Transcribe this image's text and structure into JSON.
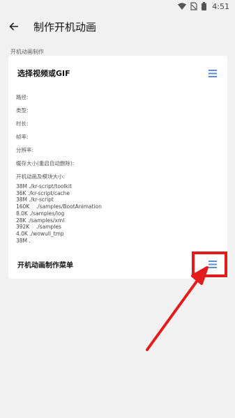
{
  "status": {
    "time": "4:51",
    "icons": [
      "wifi-icon",
      "no-sim-icon",
      "battery-icon"
    ]
  },
  "appbar": {
    "back_icon": "arrow-left-icon",
    "title": "制作开机动画"
  },
  "section_label": "开机动画制作",
  "card": {
    "title": "选择视频或GIF",
    "menu_icon": "menu-lines-icon",
    "info": [
      "路径:",
      "类型:",
      "时长:",
      "帧率:",
      "分辨率:",
      "缓存大小(重启自动删除):",
      "开机动画及模块大小:"
    ],
    "disk_usage": [
      "38M ./kr-script/toolkit",
      "36K ./kr-script/cache",
      "38M ./kr-script",
      "160K    ./samples/BootAnimation",
      "8.0K ./samples/log",
      "28K ./samples/xml",
      "392K    ./samples",
      "4.0K ./wowull_tmp",
      "38M ."
    ],
    "footer_title": "开机动画制作菜单",
    "footer_icon": "menu-lines-icon"
  },
  "colors": {
    "accent": "#5b8ed6",
    "highlight": "#e21c1c",
    "background": "#f1f1f1"
  }
}
